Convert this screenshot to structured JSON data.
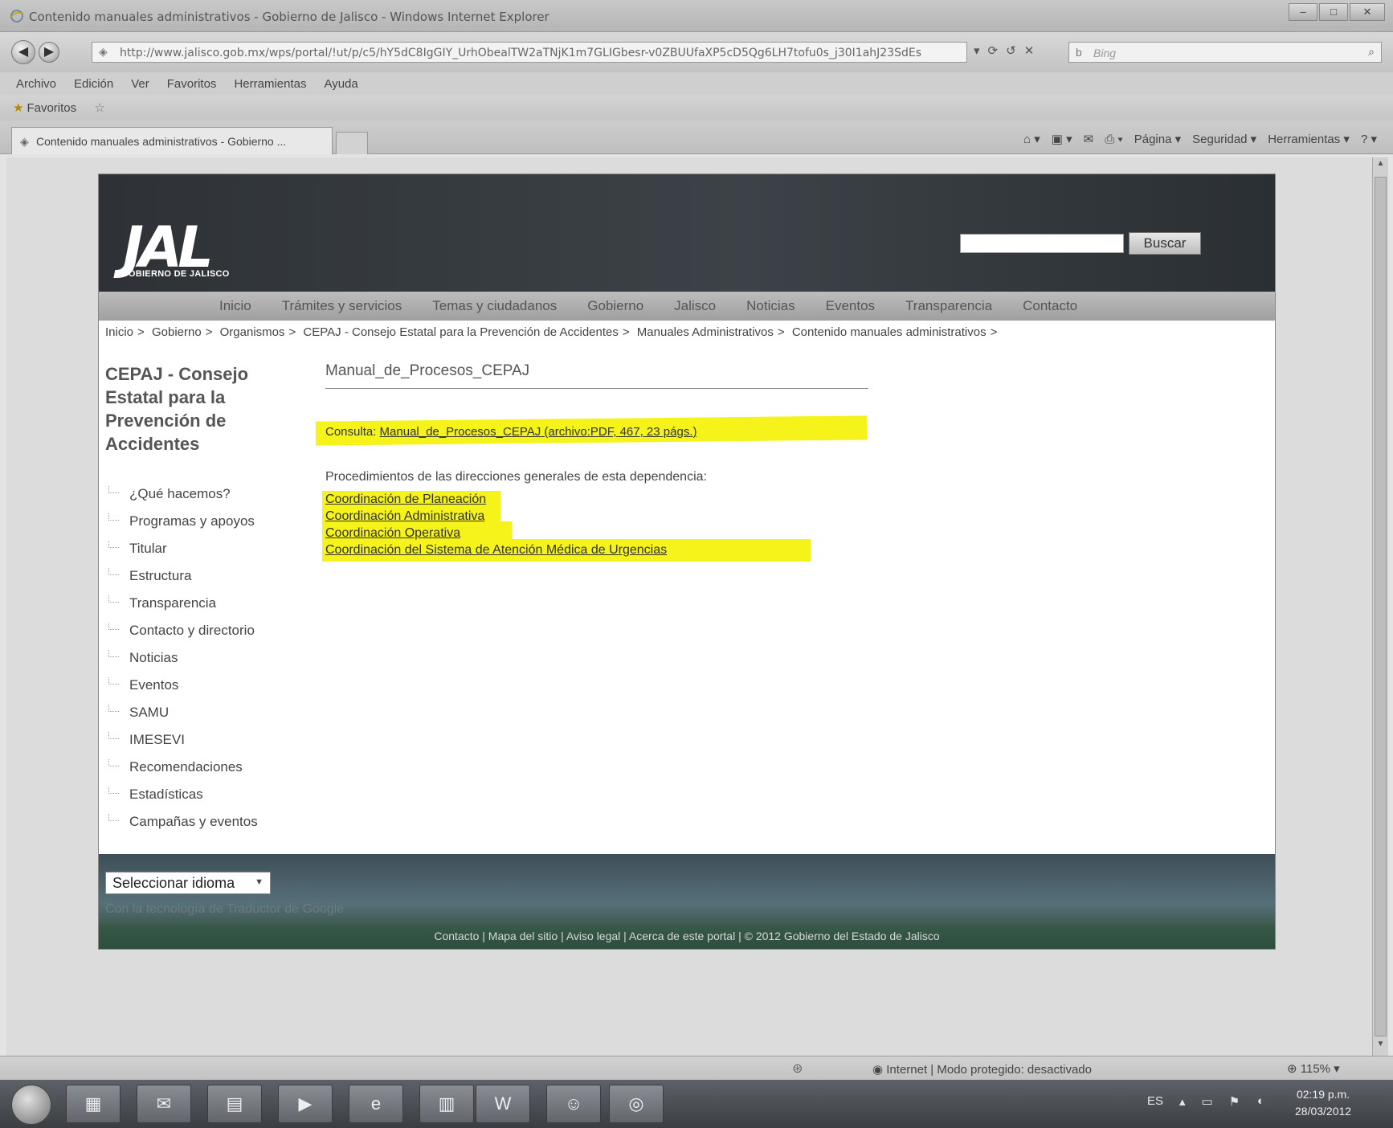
{
  "window": {
    "title": "Contenido manuales administrativos - Gobierno de Jalisco - Windows Internet Explorer",
    "url": "http://www.jalisco.gob.mx/wps/portal/!ut/p/c5/hY5dC8IgGIY_UrhObealTW2aTNjK1m7GLIGbesr-v0ZBUUfaXP5cD5Qg6LH7tofu0s_j30I1ahJ23SdEs",
    "search_placeholder": "Bing",
    "menu": [
      "Archivo",
      "Edición",
      "Ver",
      "Favoritos",
      "Herramientas",
      "Ayuda"
    ],
    "favorites_label": "Favoritos",
    "tab_title": "Contenido manuales administrativos - Gobierno ...",
    "cmd_pagina": "Página ▾",
    "cmd_seguridad": "Seguridad ▾",
    "cmd_herramientas": "Herramientas ▾"
  },
  "header": {
    "logo_text": "JAL",
    "logo_sub": "GOBIERNO DE JALISCO",
    "search_button": "Buscar"
  },
  "nav": [
    "Inicio",
    "Trámites y servicios",
    "Temas y ciudadanos",
    "Gobierno",
    "Jalisco",
    "Noticias",
    "Eventos",
    "Transparencia",
    "Contacto"
  ],
  "breadcrumb": [
    "Inicio",
    "Gobierno",
    "Organismos",
    "CEPAJ - Consejo Estatal para la Prevención de Accidentes",
    "Manuales Administrativos",
    "Contenido manuales administrativos"
  ],
  "sidebar": {
    "title": "CEPAJ - Consejo Estatal para la Prevención de Accidentes",
    "items": [
      "¿Qué hacemos?",
      "Programas y apoyos",
      "Titular",
      "Estructura",
      "Transparencia",
      "Contacto y directorio",
      "Noticias",
      "Eventos",
      "SAMU",
      "IMESEVI",
      "Recomendaciones",
      "Estadísticas",
      "Campañas y eventos"
    ]
  },
  "content": {
    "title": "Manual_de_Procesos_CEPAJ",
    "consulta_label": "Consulta:",
    "consulta_link": "Manual_de_Procesos_CEPAJ (archivo:PDF, 467, 23 págs.)",
    "procedures_intro": "Procedimientos de las direcciones generales de esta dependencia:",
    "procedures": [
      "Coordinación de Planeación",
      "Coordinación Administrativa",
      "Coordinación Operativa",
      "Coordinación del Sistema de Atención Médica de Urgencias"
    ],
    "highlight_color": "#f5f31a"
  },
  "footer": {
    "language_select": "Seleccionar idioma",
    "powered_by": "Con la tecnología de Traductor de Google",
    "links": "Contacto | Mapa del sitio | Aviso legal | Acerca de este portal | © 2012 Gobierno del Estado de Jalisco"
  },
  "statusbar": {
    "zone": "Internet | Modo protegido: desactivado",
    "zoom": "115%"
  },
  "taskbar": {
    "lang": "ES",
    "time": "02:19 p.m.",
    "date": "28/03/2012"
  }
}
